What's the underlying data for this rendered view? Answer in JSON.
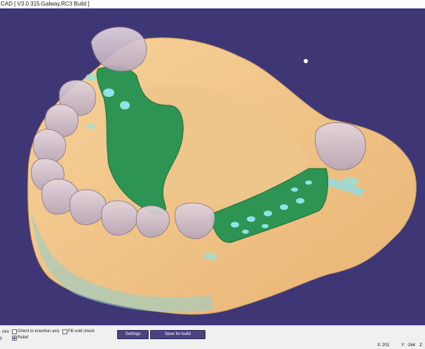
{
  "window": {
    "title": "CAD [ V3.0 315.Galway,RC3 Build ]"
  },
  "toolbar": {
    "unit_label": "mm",
    "orient_label": "Orient to insertion axis",
    "fill_void_label": "Fill void check",
    "relief_label": "Relief",
    "y_fragment": "y",
    "settings_label": "Settings",
    "save_label": "Save for build",
    "orient_checked": false,
    "fill_void_checked": false,
    "relief_checked": true
  },
  "status": {
    "x_label": "X:",
    "x_value": "201",
    "y_label": "Y:",
    "y_value": "-264",
    "z_label": "Z:"
  },
  "colors": {
    "viewport_bg": "#3f3775",
    "gum": "#f0c487",
    "teeth": "#cdbac9",
    "framework": "#2e9454",
    "relief": "#7fd6df",
    "button_bg": "#4b4380"
  }
}
